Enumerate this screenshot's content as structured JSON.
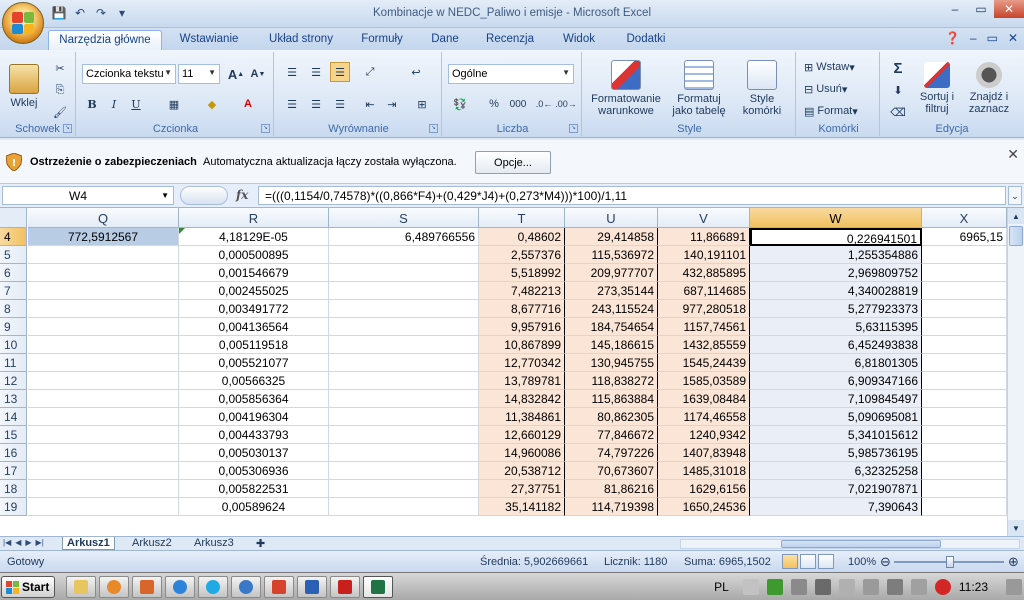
{
  "window": {
    "title": "Kombinacje w NEDC_Paliwo i emisje - Microsoft Excel",
    "minimize": "–",
    "close": "✕"
  },
  "tabs": [
    "Narzędzia główne",
    "Wstawianie",
    "Układ strony",
    "Formuły",
    "Dane",
    "Recenzja",
    "Widok",
    "Dodatki"
  ],
  "ribbon": {
    "clipboard": {
      "paste": "Wklej",
      "label": "Schowek"
    },
    "font": {
      "name": "Czcionka tekstu",
      "size": "11",
      "label": "Czcionka",
      "bold": "B",
      "italic": "I",
      "underline": "U"
    },
    "alignment": {
      "label": "Wyrównanie"
    },
    "number": {
      "format": "Ogólne",
      "label": "Liczba",
      "percent": "%",
      "thousands": "000"
    },
    "styles": {
      "conditional": "Formatowanie warunkowe",
      "table": "Formatuj jako tabelę",
      "cell": "Style komórki",
      "label": "Style"
    },
    "cells": {
      "insert": "Wstaw",
      "delete": "Usuń",
      "format": "Format",
      "label": "Komórki"
    },
    "editing": {
      "sort": "Sortuj i filtruj",
      "find": "Znajdź i zaznacz",
      "label": "Edycja"
    }
  },
  "security": {
    "title": "Ostrzeżenie o zabezpieczeniach",
    "message": "Automatyczna aktualizacja łączy została wyłączona.",
    "options": "Opcje..."
  },
  "formula_bar": {
    "name_box": "W4",
    "fx": "fx",
    "formula": "=(((0,1154/0,74578)*((0,866*F4)+(0,429*J4)+(0,273*M4)))*100)/1,11"
  },
  "columns": [
    "Q",
    "R",
    "S",
    "T",
    "U",
    "V",
    "W",
    "X"
  ],
  "rows": [
    {
      "n": "4",
      "Q": "772,5912567",
      "R": "4,18129E-05",
      "S": "6,489766556",
      "T": "0,48602",
      "U": "29,414858",
      "V": "11,866891",
      "W": "0,226941501",
      "X": "6965,15"
    },
    {
      "n": "5",
      "Q": "",
      "R": "0,000500895",
      "S": "",
      "T": "2,557376",
      "U": "115,536972",
      "V": "140,191101",
      "W": "1,255354886",
      "X": ""
    },
    {
      "n": "6",
      "Q": "",
      "R": "0,001546679",
      "S": "",
      "T": "5,518992",
      "U": "209,977707",
      "V": "432,885895",
      "W": "2,969809752",
      "X": ""
    },
    {
      "n": "7",
      "Q": "",
      "R": "0,002455025",
      "S": "",
      "T": "7,482213",
      "U": "273,35144",
      "V": "687,114685",
      "W": "4,340028819",
      "X": ""
    },
    {
      "n": "8",
      "Q": "",
      "R": "0,003491772",
      "S": "",
      "T": "8,677716",
      "U": "243,115524",
      "V": "977,280518",
      "W": "5,277923373",
      "X": ""
    },
    {
      "n": "9",
      "Q": "",
      "R": "0,004136564",
      "S": "",
      "T": "9,957916",
      "U": "184,754654",
      "V": "1157,74561",
      "W": "5,63115395",
      "X": ""
    },
    {
      "n": "10",
      "Q": "",
      "R": "0,005119518",
      "S": "",
      "T": "10,867899",
      "U": "145,186615",
      "V": "1432,85559",
      "W": "6,452493838",
      "X": ""
    },
    {
      "n": "11",
      "Q": "",
      "R": "0,005521077",
      "S": "",
      "T": "12,770342",
      "U": "130,945755",
      "V": "1545,24439",
      "W": "6,81801305",
      "X": ""
    },
    {
      "n": "12",
      "Q": "",
      "R": "0,00566325",
      "S": "",
      "T": "13,789781",
      "U": "118,838272",
      "V": "1585,03589",
      "W": "6,909347166",
      "X": ""
    },
    {
      "n": "13",
      "Q": "",
      "R": "0,005856364",
      "S": "",
      "T": "14,832842",
      "U": "115,863884",
      "V": "1639,08484",
      "W": "7,109845497",
      "X": ""
    },
    {
      "n": "14",
      "Q": "",
      "R": "0,004196304",
      "S": "",
      "T": "11,384861",
      "U": "80,862305",
      "V": "1174,46558",
      "W": "5,090695081",
      "X": ""
    },
    {
      "n": "15",
      "Q": "",
      "R": "0,004433793",
      "S": "",
      "T": "12,660129",
      "U": "77,846672",
      "V": "1240,9342",
      "W": "5,341015612",
      "X": ""
    },
    {
      "n": "16",
      "Q": "",
      "R": "0,005030137",
      "S": "",
      "T": "14,960086",
      "U": "74,797226",
      "V": "1407,83948",
      "W": "5,985736195",
      "X": ""
    },
    {
      "n": "17",
      "Q": "",
      "R": "0,005306936",
      "S": "",
      "T": "20,538712",
      "U": "70,673607",
      "V": "1485,31018",
      "W": "6,32325258",
      "X": ""
    },
    {
      "n": "18",
      "Q": "",
      "R": "0,005822531",
      "S": "",
      "T": "27,37751",
      "U": "81,86216",
      "V": "1629,6156",
      "W": "7,021907871",
      "X": ""
    },
    {
      "n": "19",
      "Q": "",
      "R": "0,00589624",
      "S": "",
      "T": "35,141182",
      "U": "114,719398",
      "V": "1650,24536",
      "W": "7,390643",
      "X": ""
    }
  ],
  "sheets": [
    "Arkusz1",
    "Arkusz2",
    "Arkusz3"
  ],
  "status": {
    "ready": "Gotowy",
    "average": "Średnia: 5,902669661",
    "count": "Licznik: 1180",
    "sum": "Suma: 6965,1502",
    "zoom": "100%"
  },
  "taskbar": {
    "start": "Start",
    "lang": "PL",
    "clock": "11:23"
  }
}
